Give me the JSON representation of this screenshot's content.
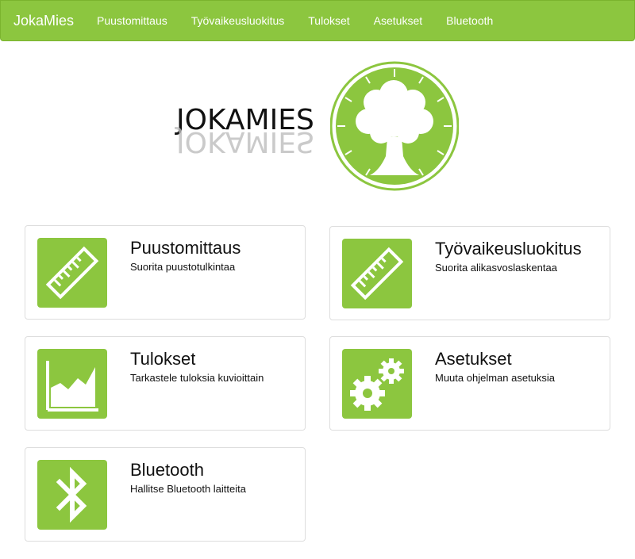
{
  "navbar": {
    "brand": "JokaMies",
    "links": [
      "Puustomittaus",
      "Työvaikeusluokitus",
      "Tulokset",
      "Asetukset",
      "Bluetooth"
    ]
  },
  "logo": {
    "text": "JOKAMIES"
  },
  "cards": [
    {
      "title": "Puustomittaus",
      "desc": "Suorita puustotulkintaa",
      "icon": "ruler-icon"
    },
    {
      "title": "Työvaikeusluokitus",
      "desc": "Suorita alikasvoslaskentaa",
      "icon": "ruler-icon"
    },
    {
      "title": "Tulokset",
      "desc": "Tarkastele tuloksia kuvioittain",
      "icon": "area-chart-icon"
    },
    {
      "title": "Asetukset",
      "desc": "Muuta ohjelman asetuksia",
      "icon": "gears-icon"
    },
    {
      "title": "Bluetooth",
      "desc": "Hallitse Bluetooth laitteita",
      "icon": "bluetooth-icon"
    }
  ],
  "colors": {
    "accent": "#8cc63f",
    "border": "#dddddd"
  }
}
